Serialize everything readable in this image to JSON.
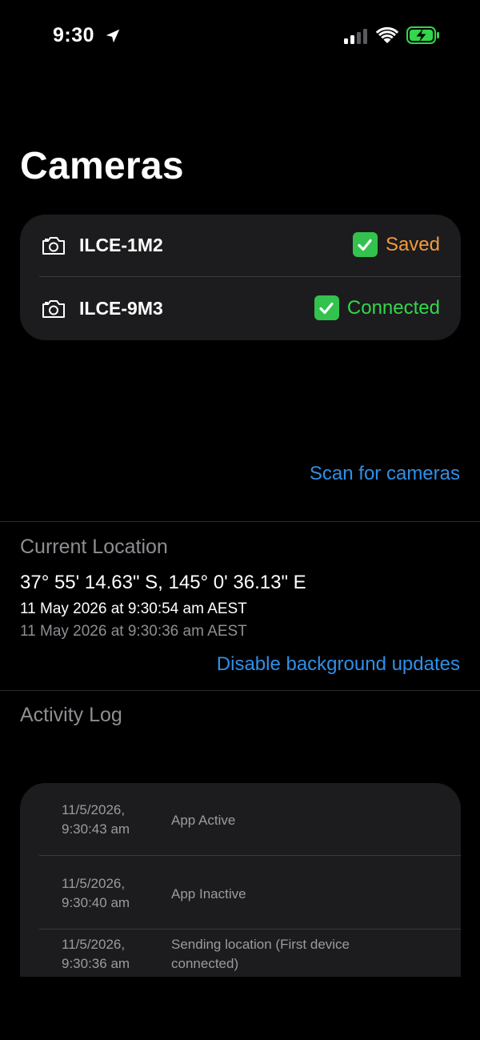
{
  "status_bar": {
    "time": "9:30",
    "icons": [
      "location-arrow-icon",
      "signal-icon",
      "wifi-icon",
      "battery-charging-icon"
    ]
  },
  "page_title": "Cameras",
  "cameras": [
    {
      "name": "ILCE-1M2",
      "status": "Saved",
      "status_color": "#f19a3e"
    },
    {
      "name": "ILCE-9M3",
      "status": "Connected",
      "status_color": "#32d74b"
    }
  ],
  "scan_link": "Scan for cameras",
  "location": {
    "label": "Current Location",
    "coordinates": "37° 55' 14.63\" S, 145° 0' 36.13\" E",
    "timestamp_primary": "11 May 2026 at 9:30:54 am AEST",
    "timestamp_secondary": "11 May 2026 at 9:30:36 am AEST",
    "toggle_link": "Disable background updates"
  },
  "activity": {
    "label": "Activity Log",
    "entries": [
      {
        "date": "11/5/2026, 9:30:43 am",
        "message": "App Active"
      },
      {
        "date": "11/5/2026, 9:30:40 am",
        "message": "App Inactive"
      },
      {
        "date": "11/5/2026, 9:30:36 am",
        "message": "Sending location (First device connected)"
      }
    ]
  },
  "colors": {
    "accent": "#2f8fe8",
    "card": "#1c1c1e",
    "secondary_text": "#8e8e93"
  }
}
